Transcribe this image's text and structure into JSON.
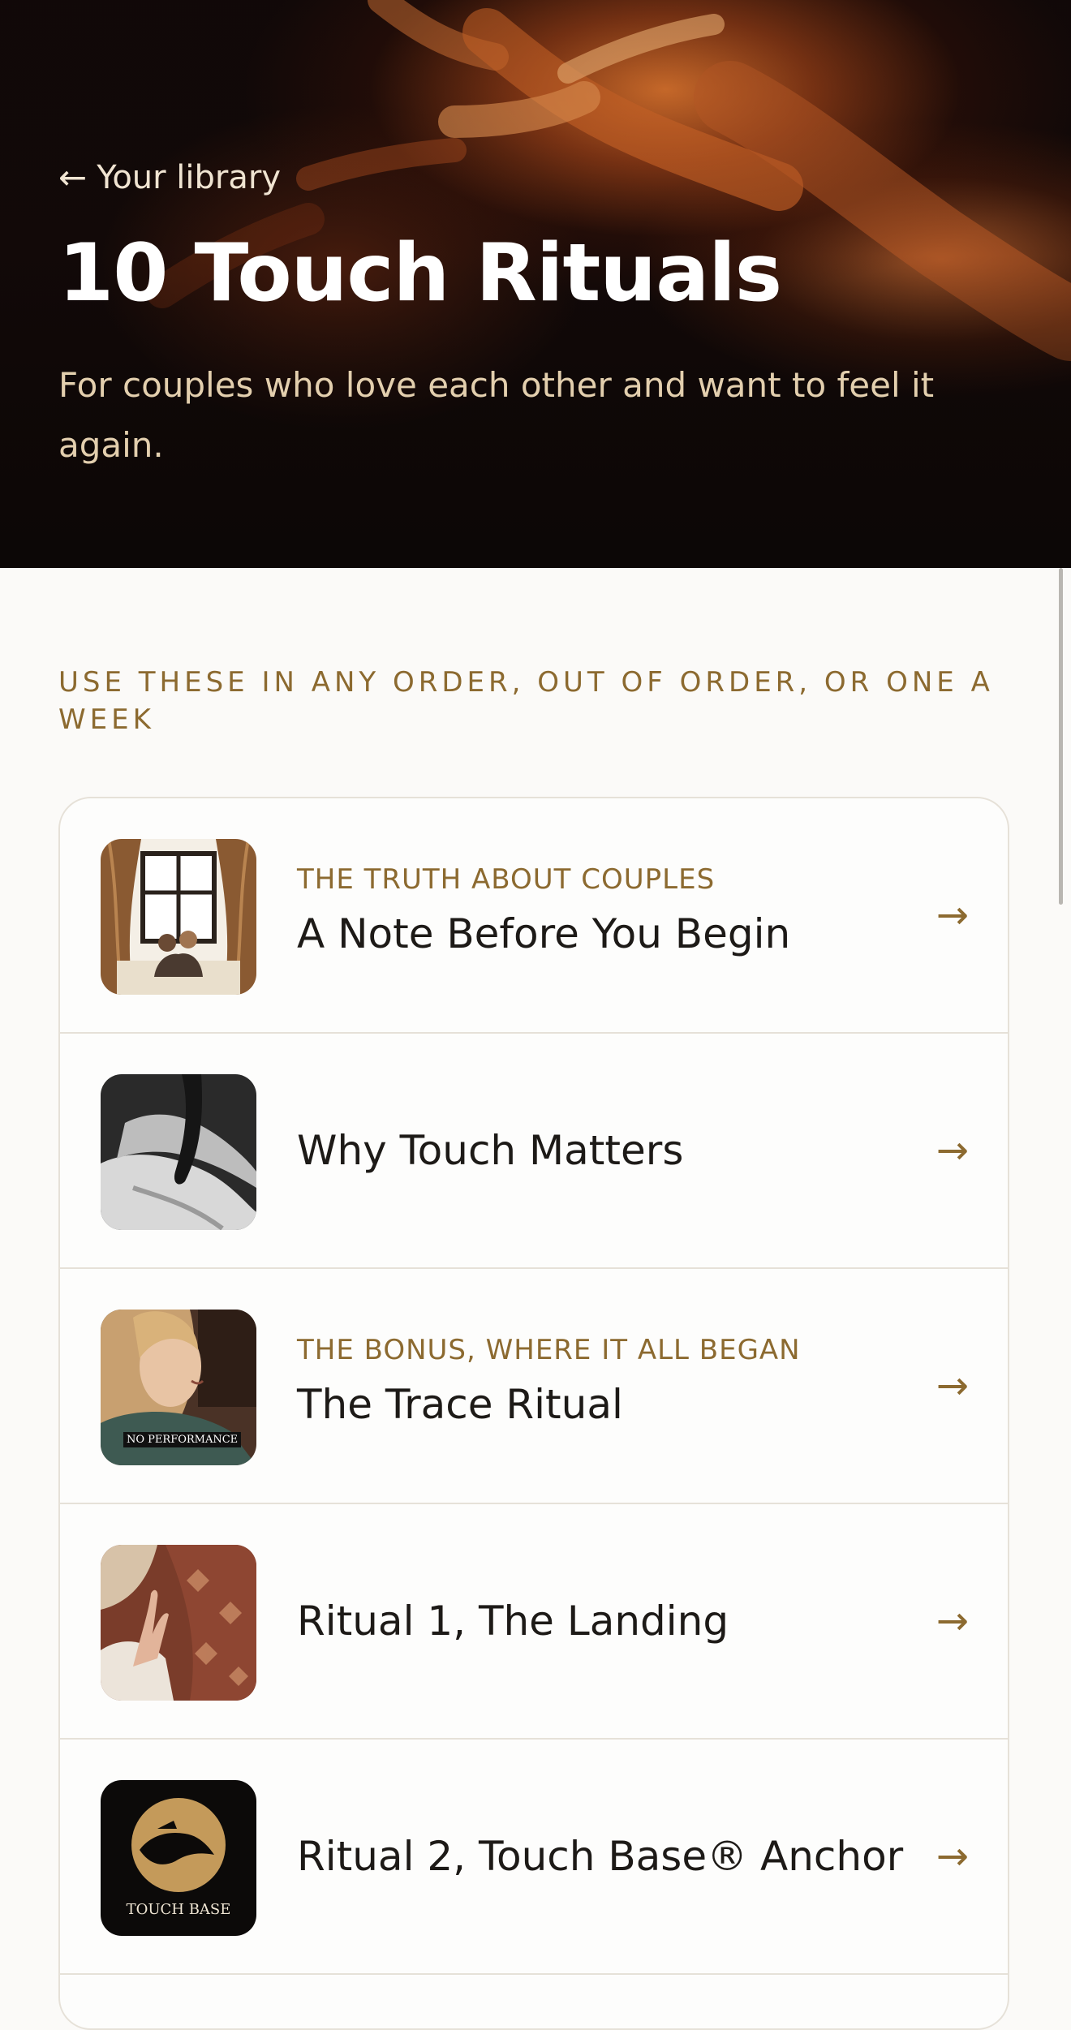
{
  "header": {
    "back_label": "Your library",
    "back_arrow": "←",
    "title": "10 Touch Rituals",
    "subtitle": "For couples who love each other and want to feel it again."
  },
  "section_label": "USE THESE IN ANY ORDER, OUT OF ORDER, OR ONE A WEEK",
  "colors": {
    "accent": "#8c6a30",
    "background": "#fbfaf8",
    "card_border": "#e6e1d8",
    "title_text": "#1d1a17"
  },
  "rituals": [
    {
      "kicker": "THE TRUTH ABOUT COUPLES",
      "title": "A Note Before You Begin",
      "arrow": "→",
      "thumb": "couple-by-window-image"
    },
    {
      "kicker": "",
      "title": "Why Touch Matters",
      "arrow": "→",
      "thumb": "hands-black-white-image"
    },
    {
      "kicker": "THE BONUS, WHERE IT ALL BEGAN",
      "title": "The Trace Ritual",
      "arrow": "→",
      "thumb": "woman-smiling-image",
      "thumb_caption": "NO PERFORMANCE"
    },
    {
      "kicker": "",
      "title": "Ritual 1, The Landing",
      "arrow": "→",
      "thumb": "hands-on-blanket-image"
    },
    {
      "kicker": "",
      "title": "Ritual 2, Touch Base® Anchor",
      "arrow": "→",
      "thumb": "touch-base-logo",
      "thumb_caption": "TOUCH BASE"
    }
  ]
}
